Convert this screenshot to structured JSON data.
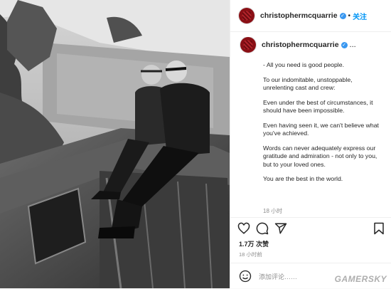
{
  "post": {
    "username": "christophermcquarrie",
    "follow_label": "关注",
    "more_label": "..."
  },
  "caption": {
    "username": "christophermcquarrie",
    "ellipsis": "...",
    "paragraphs": [
      "- All you need is good people.",
      "To our indomitable, unstoppable, unrelenting cast and crew:",
      "Even under the best of circumstances, it should have been impossible.",
      "Even having seen it, we can't believe what you've achieved.",
      "Words can never adequately express our gratitude and admiration - not only to you, but to your loved ones.",
      "You are the best in the world."
    ],
    "time": "18 小时"
  },
  "actions": {
    "likes": "1.7万 次赞",
    "ago": "18 小时前",
    "comment_placeholder": "添加评论……"
  },
  "watermark": "GAMERSKY",
  "colors": {
    "accent": "#0095f6",
    "verified": "#3897f0",
    "avatar": "#b1232a"
  }
}
